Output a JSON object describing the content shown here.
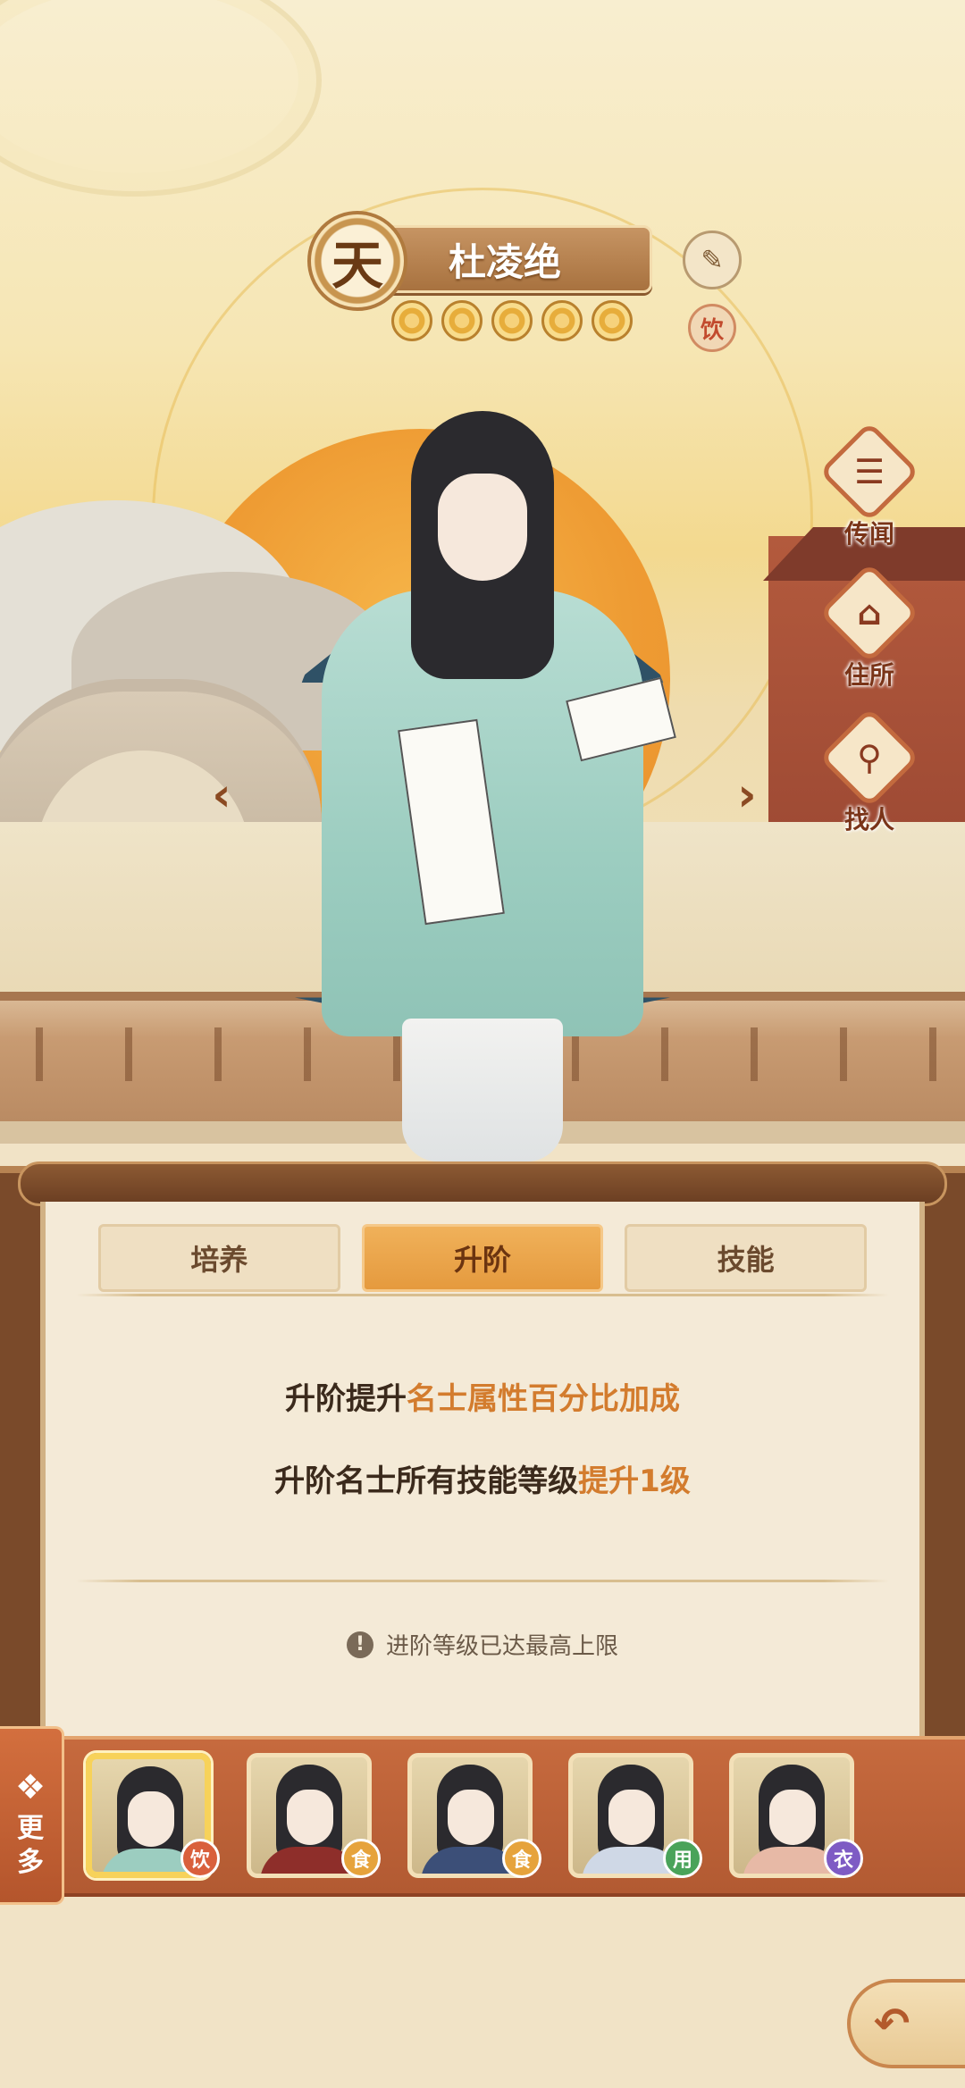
{
  "hero": {
    "rank_char": "天",
    "name": "杜凌绝",
    "stars": 5,
    "type_tag": "饮"
  },
  "side_buttons": [
    {
      "glyph": "☰",
      "label": "传闻",
      "icon": "scroll-icon"
    },
    {
      "glyph": "⌂",
      "label": "住所",
      "icon": "house-icon"
    },
    {
      "glyph": "⚲",
      "label": "找人",
      "icon": "gourd-search-icon"
    }
  ],
  "nav": {
    "prev": "‹",
    "next": "›"
  },
  "tabs": [
    {
      "label": "培养",
      "active": false
    },
    {
      "label": "升阶",
      "active": true
    },
    {
      "label": "技能",
      "active": false
    }
  ],
  "info": {
    "line1_prefix": "升阶提升",
    "line1_highlight": "名士属性百分比加成",
    "line2_prefix": "升阶名士所有技能等级",
    "line2_highlight": "提升1级",
    "notice_icon": "!",
    "notice": "进阶等级已达最高上限"
  },
  "roster": {
    "more_icon": "❖",
    "more_label": "更多",
    "members": [
      {
        "tag": "饮",
        "tag_color": "#d9603c",
        "robe_color": "#9ccdc0",
        "selected": true
      },
      {
        "tag": "食",
        "tag_color": "#e6a33c",
        "robe_color": "#8e2e2a",
        "selected": false
      },
      {
        "tag": "食",
        "tag_color": "#e6a33c",
        "robe_color": "#3c4f78",
        "selected": false
      },
      {
        "tag": "用",
        "tag_color": "#4aa35a",
        "robe_color": "#cfd8e6",
        "selected": false
      },
      {
        "tag": "衣",
        "tag_color": "#7e5bc4",
        "robe_color": "#e7b9a6",
        "selected": false
      }
    ]
  },
  "back_button": {
    "glyph": "↶"
  },
  "colors": {
    "accent": "#e59a3e",
    "highlight_text": "#d37c2e",
    "panel_bg": "#f4ead7",
    "roster_bar": "#c66a3e"
  }
}
